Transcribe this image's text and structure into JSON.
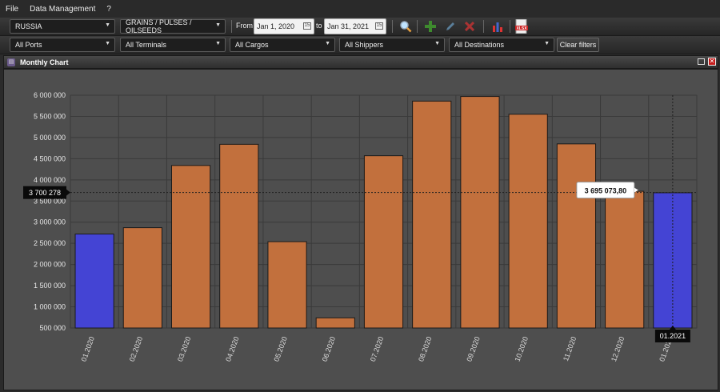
{
  "menu": {
    "file": "File",
    "data_management": "Data Management",
    "help": "?"
  },
  "toolbar": {
    "country": "RUSSIA",
    "commodity": "GRAINS / PULSES / OILSEEDS",
    "from_label": "From",
    "from_date": "Jan 1, 2020",
    "to_label": "to",
    "to_date": "Jan 31, 2021"
  },
  "icons": {
    "search": "magnifier-icon",
    "add": "plus-icon",
    "edit": "pencil-icon",
    "delete": "x-icon",
    "chart": "bar-chart-icon",
    "export": "xlsx-icon"
  },
  "filters": {
    "ports": "All Ports",
    "terminals": "All Terminals",
    "cargos": "All Cargos",
    "shippers": "All Shippers",
    "destinations": "All Destinations",
    "clear": "Clear filters"
  },
  "panel": {
    "title": "Monthly Chart"
  },
  "colors": {
    "bar": "#c2703d",
    "bar_selected": "#4444d4",
    "grid": "#3a3a3a",
    "plot_bg": "#4e4e4e"
  },
  "chart_data": {
    "type": "bar",
    "categories": [
      "01.2020",
      "02.2020",
      "03.2020",
      "04.2020",
      "05.2020",
      "06.2020",
      "07.2020",
      "08.2020",
      "09.2020",
      "10.2020",
      "11.2020",
      "12.2020",
      "01.2021"
    ],
    "values": [
      2720000,
      2870000,
      4340000,
      4840000,
      2540000,
      740000,
      4570000,
      5860000,
      5970000,
      5550000,
      4850000,
      3730000,
      3695073.8
    ],
    "highlighted_indices": [
      0,
      12
    ],
    "ylim": [
      500000,
      6000000
    ],
    "yticks": [
      500000,
      1000000,
      1500000,
      2000000,
      2500000,
      3000000,
      3500000,
      4000000,
      4500000,
      5000000,
      5500000,
      6000000
    ],
    "ytick_labels": [
      "500 000",
      "1 000 000",
      "1 500 000",
      "2 000 000",
      "2 500 000",
      "3 000 000",
      "3 500 000",
      "4 000 000",
      "4 500 000",
      "5 000 000",
      "5 500 000",
      "6 000 000"
    ],
    "crosshair": {
      "y_value": 3700278,
      "y_label": "3 700 278",
      "x_category": "01.2021",
      "tooltip": "3 695 073,80"
    },
    "grid": true
  }
}
